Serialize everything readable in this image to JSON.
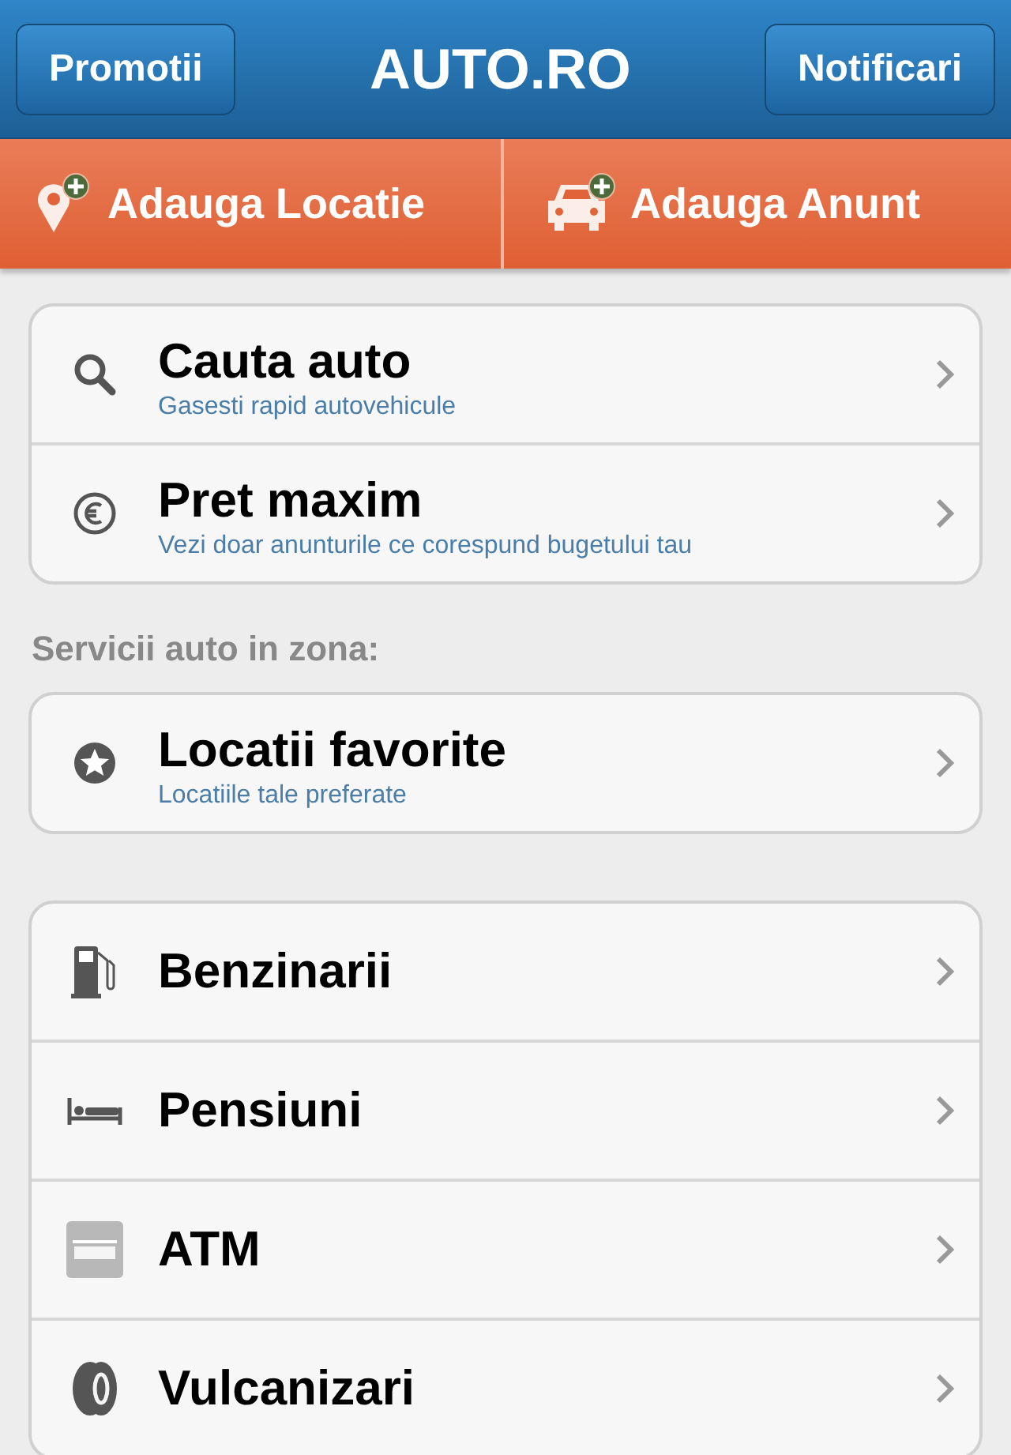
{
  "nav_bar": {
    "left_button": "Promotii",
    "title": "AUTO.RO",
    "right_button": "Notificari"
  },
  "actions": [
    {
      "kind": "pin",
      "label": "Adauga Locatie"
    },
    {
      "kind": "car",
      "label": "Adauga Anunt"
    }
  ],
  "groups": [
    {
      "items": [
        {
          "kind": "search",
          "title": "Cauta auto",
          "subtitle": "Gasesti rapid autovehicule"
        },
        {
          "kind": "euro",
          "title": "Pret maxim",
          "subtitle": "Vezi doar anunturile ce corespund bugetului tau"
        }
      ]
    },
    {
      "heading": "Servicii auto in zona:",
      "items": [
        {
          "kind": "star",
          "title": "Locatii favorite",
          "subtitle": "Locatiile tale preferate"
        }
      ]
    },
    {
      "items": [
        {
          "kind": "fuel",
          "title": "Benzinarii"
        },
        {
          "kind": "bed",
          "title": "Pensiuni"
        },
        {
          "kind": "atm",
          "title": "ATM"
        },
        {
          "kind": "tire",
          "title": "Vulcanizari"
        }
      ]
    }
  ]
}
